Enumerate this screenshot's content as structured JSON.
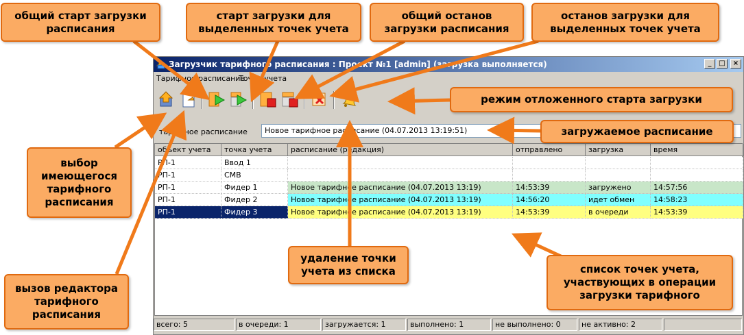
{
  "window": {
    "title": "Загрузчик тарифного расписания : Проект №1 [admin] (загрузка выполняется)",
    "buttons": {
      "minimize": "_",
      "maximize": "□",
      "close": "×"
    }
  },
  "menu": {
    "items": [
      "Тарифное расписание",
      "Точки учета"
    ]
  },
  "toolbar": {
    "icons": [
      "select-schedule-icon",
      "edit-schedule-icon",
      "start-all-icon",
      "start-selected-icon",
      "stop-all-icon",
      "stop-selected-icon",
      "delete-point-icon",
      "deferred-start-bell-icon"
    ]
  },
  "schedule": {
    "label": "тарифное расписание",
    "value": "Новое тарифное расписание (04.07.2013 13:19:51)"
  },
  "grid": {
    "columns": [
      "объект учета",
      "точка учета",
      "расписание (редакция)",
      "отправлено",
      "загрузка",
      "время"
    ],
    "rows": [
      {
        "object": "РП-1",
        "point": "Ввод 1",
        "schedule": "",
        "sent": "",
        "load": "",
        "time": "",
        "color": "#ffffff",
        "selected": false
      },
      {
        "object": "РП-1",
        "point": "СМВ",
        "schedule": "",
        "sent": "",
        "load": "",
        "time": "",
        "color": "#ffffff",
        "selected": false
      },
      {
        "object": "РП-1",
        "point": "Фидер 1",
        "schedule": "Новое тарифное расписание  (04.07.2013 13:19)",
        "sent": "14:53:39",
        "load": "загружено",
        "time": "14:57:56",
        "color": "#c8e6c8",
        "selected": false
      },
      {
        "object": "РП-1",
        "point": "Фидер 2",
        "schedule": "Новое тарифное расписание  (04.07.2013 13:19)",
        "sent": "14:56:20",
        "load": "идет обмен",
        "time": "14:58:23",
        "color": "#80ffff",
        "selected": false
      },
      {
        "object": "РП-1",
        "point": "Фидер 3",
        "schedule": "Новое тарифное расписание  (04.07.2013 13:19)",
        "sent": "14:53:39",
        "load": "в очереди",
        "time": "14:53:39",
        "color": "#ffff80",
        "selected": true
      }
    ]
  },
  "status": [
    "всего: 5",
    "в очереди: 1",
    "загружается: 1",
    "выполнено: 1",
    "не выполнено: 0",
    "не активно: 2"
  ],
  "callouts": {
    "start_all": "общий старт загрузки\nрасписания",
    "start_selected": "старт загрузки для\nвыделенных точек учета",
    "stop_all": "общий останов\nзагрузки расписания",
    "stop_selected": "останов загрузки для\nвыделенных точек учета",
    "deferred": "режим отложенного старта загрузки",
    "loaded_schedule": "загружаемое расписание",
    "select_existing": "выбор\nимеющегося\nтарифного\nрасписания",
    "call_editor": "вызов редактора\nтарифного\nрасписания",
    "delete_point": "удаление точки\nучета из списка",
    "points_list": "список точек учета,\nучаствующих в операции\nзагрузки тарифного"
  },
  "colors": {
    "callout_fill": "#fbab63",
    "callout_border": "#e06a10",
    "arrow": "#f07a1a",
    "selection": "#0a246a"
  }
}
